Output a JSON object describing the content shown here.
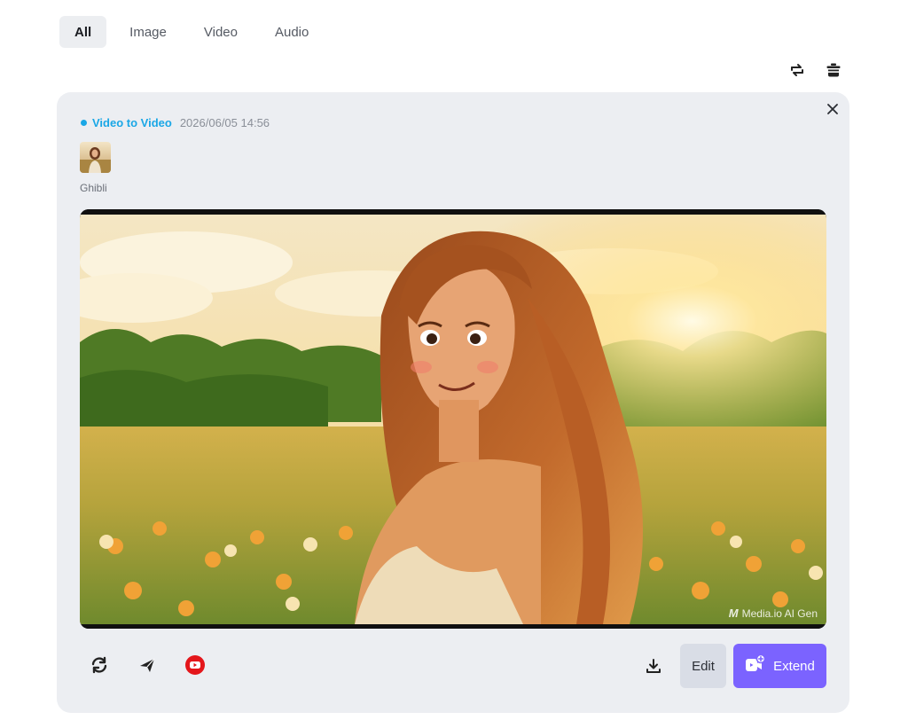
{
  "tabs": [
    {
      "label": "All",
      "active": true
    },
    {
      "label": "Image",
      "active": false
    },
    {
      "label": "Video",
      "active": false
    },
    {
      "label": "Audio",
      "active": false
    }
  ],
  "toolbar": {
    "refresh_icon": "swap-arrows-icon",
    "clear_icon": "trash-icon"
  },
  "card": {
    "type_label": "Video to Video",
    "timestamp": "2026/06/05 14:56",
    "style_name": "Ghibli",
    "watermark": "Media.io AI Gen",
    "watermark_logo": "M",
    "actions": {
      "regenerate_icon": "regenerate-icon",
      "share_icon": "send-icon",
      "youtube_icon": "youtube-icon",
      "download_icon": "download-icon",
      "edit_label": "Edit",
      "extend_label": "Extend"
    }
  },
  "colors": {
    "accent": "#7b63ff",
    "type_label": "#1aa7e6",
    "youtube": "#e4161b",
    "card_bg": "#eceef2"
  }
}
